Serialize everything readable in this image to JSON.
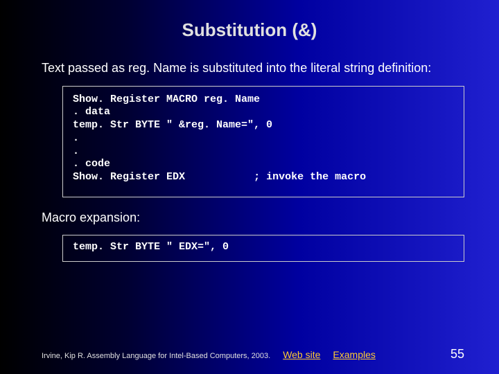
{
  "title": "Substitution (&)",
  "intro": "Text passed as reg. Name is substituted into the literal string definition:",
  "code1_line1": "Show. Register MACRO reg. Name",
  "code1_line2": ". data",
  "code1_line3": "temp. Str BYTE \" &reg. Name=\", 0",
  "code1_line4": ".",
  "code1_line5": ".",
  "code1_line6": ". code",
  "code1_line7a": "Show. Register EDX",
  "code1_line7b": "; invoke the macro",
  "expansion_label": "Macro expansion:",
  "code2_line1": "temp. Str BYTE \" EDX=\", 0",
  "footer_credit": "Irvine, Kip R. Assembly Language for Intel-Based Computers, 2003.",
  "link_web": "Web site",
  "link_examples": "Examples",
  "page_number": "55"
}
